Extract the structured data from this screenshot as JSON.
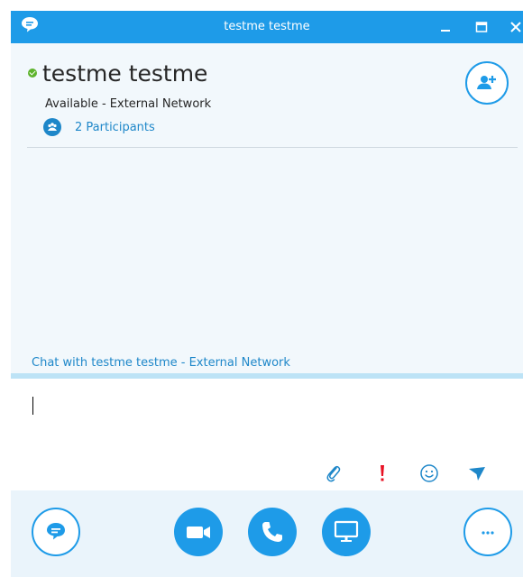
{
  "window": {
    "title": "testme testme"
  },
  "header": {
    "contact_name": "testme testme",
    "status": "Available - External Network",
    "participants_label": "2 Participants",
    "presence_color": "#5db32c"
  },
  "conversation": {
    "chat_with_label": "Chat with testme testme - External Network"
  },
  "compose": {
    "value": ""
  },
  "icons": {
    "title": "chat-bubble-icon",
    "minimize": "minimize-icon",
    "maximize": "maximize-icon",
    "close": "close-icon",
    "participants": "participants-icon",
    "add_person": "add-person-icon",
    "attach": "paperclip-icon",
    "important": "exclamation-icon",
    "emoji": "smiley-icon",
    "send": "send-arrow-icon",
    "im": "instant-message-icon",
    "video": "video-camera-icon",
    "call": "phone-icon",
    "present": "monitor-icon",
    "more": "more-options-icon"
  },
  "colors": {
    "accent": "#1e9be8",
    "link": "#1e87c9",
    "important": "#e81123"
  }
}
